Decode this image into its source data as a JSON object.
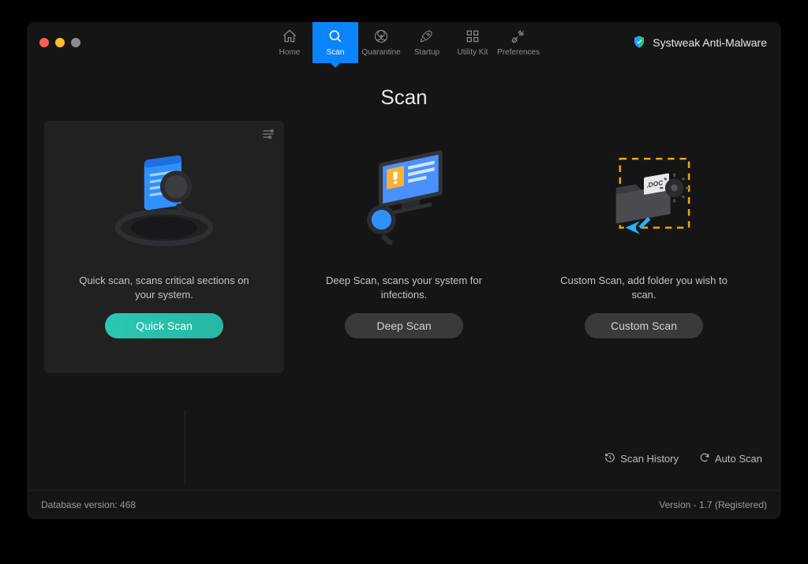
{
  "brand": {
    "name": "Systweak Anti-Malware"
  },
  "nav": {
    "items": [
      {
        "label": "Home"
      },
      {
        "label": "Scan"
      },
      {
        "label": "Quarantine"
      },
      {
        "label": "Startup"
      },
      {
        "label": "Utility Kit"
      },
      {
        "label": "Preferences"
      }
    ],
    "active_index": 1
  },
  "page": {
    "title": "Scan"
  },
  "cards": [
    {
      "description": "Quick scan, scans critical sections on your system.",
      "button_label": "Quick Scan"
    },
    {
      "description": "Deep Scan, scans your system for infections.",
      "button_label": "Deep Scan"
    },
    {
      "description": "Custom Scan, add folder you wish to scan.",
      "button_label": "Custom Scan"
    }
  ],
  "footer_links": {
    "scan_history": "Scan History",
    "auto_scan": "Auto Scan"
  },
  "status": {
    "db_version_label": "Database version: 468",
    "app_version_label": "Version  -  1.7 (Registered)"
  }
}
